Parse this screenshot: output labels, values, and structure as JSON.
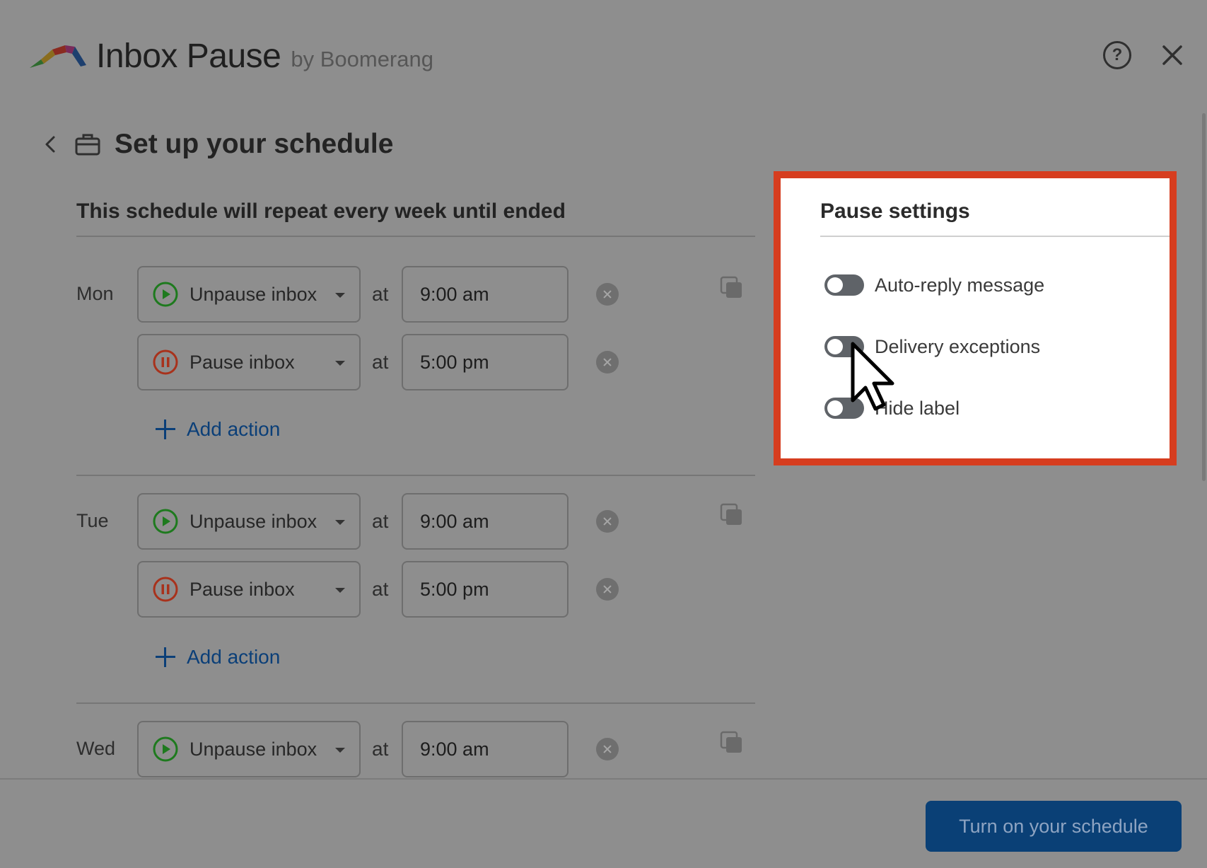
{
  "app": {
    "title": "Inbox Pause",
    "by": "by Boomerang"
  },
  "header": {
    "help_icon": "help-circle-icon",
    "close_icon": "close-icon"
  },
  "page": {
    "title": "Set up your schedule",
    "subtitle": "This schedule will repeat every week until ended"
  },
  "schedule": {
    "at_label": "at",
    "add_action_label": "Add action",
    "days": [
      {
        "day": "Mon",
        "actions": [
          {
            "type": "unpause",
            "label": "Unpause inbox",
            "time": "9:00 am"
          },
          {
            "type": "pause",
            "label": "Pause inbox",
            "time": "5:00 pm"
          }
        ]
      },
      {
        "day": "Tue",
        "actions": [
          {
            "type": "unpause",
            "label": "Unpause inbox",
            "time": "9:00 am"
          },
          {
            "type": "pause",
            "label": "Pause inbox",
            "time": "5:00 pm"
          }
        ]
      },
      {
        "day": "Wed",
        "actions": [
          {
            "type": "unpause",
            "label": "Unpause inbox",
            "time": "9:00 am"
          }
        ]
      }
    ]
  },
  "pause_settings": {
    "title": "Pause settings",
    "toggles": [
      {
        "label": "Auto-reply message",
        "on": false
      },
      {
        "label": "Delivery exceptions",
        "on": false
      },
      {
        "label": "Hide label",
        "on": false
      }
    ]
  },
  "footer": {
    "primary_label": "Turn on your schedule"
  },
  "colors": {
    "overlay": "#8e8e8e",
    "primary": "#0a4076",
    "highlight": "#d63d1f",
    "unpause": "#1e7a1e",
    "pause": "#a8321c"
  }
}
